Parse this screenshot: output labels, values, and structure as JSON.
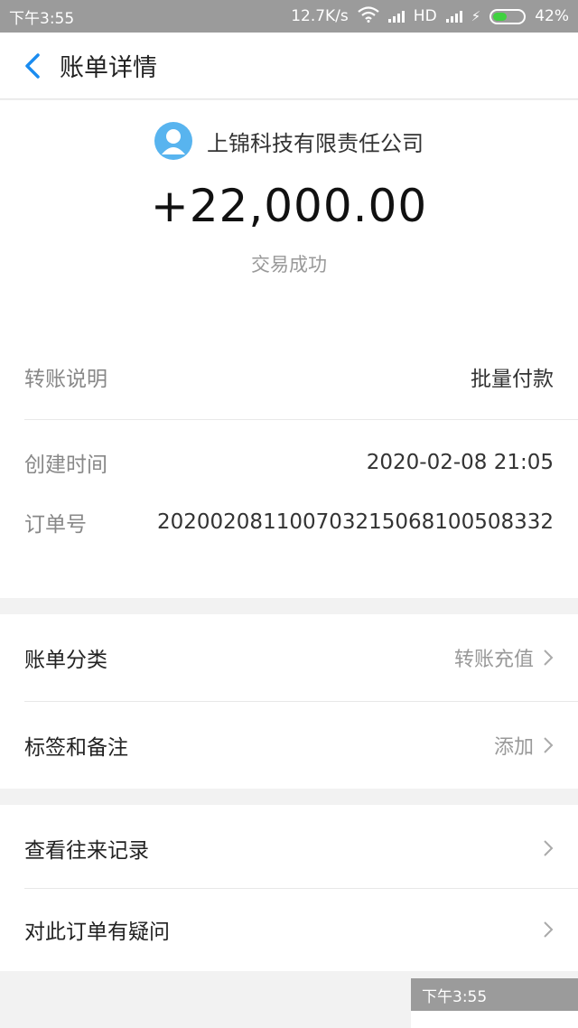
{
  "status_bar": {
    "time": "下午3:55",
    "net_speed": "12.7K/s",
    "hd": "HD",
    "battery": "42%"
  },
  "header": {
    "title": "账单详情"
  },
  "summary": {
    "merchant": "上锦科技有限责任公司",
    "amount": "+22,000.00",
    "status": "交易成功"
  },
  "details": [
    {
      "label": "转账说明",
      "value": "批量付款"
    },
    {
      "label": "创建时间",
      "value": "2020-02-08 21:05"
    },
    {
      "label": "订单号",
      "value": "202002081100703215068100508332"
    }
  ],
  "actions_1": [
    {
      "label": "账单分类",
      "value": "转账充值"
    },
    {
      "label": "标签和备注",
      "value": "添加"
    }
  ],
  "actions_2": [
    {
      "label": "查看往来记录"
    },
    {
      "label": "对此订单有疑问"
    }
  ],
  "overlay": {
    "time": "下午3:55"
  },
  "colors": {
    "accent": "#1a8cf0",
    "avatar": "#58b4ef",
    "battery": "#3fd13f"
  }
}
